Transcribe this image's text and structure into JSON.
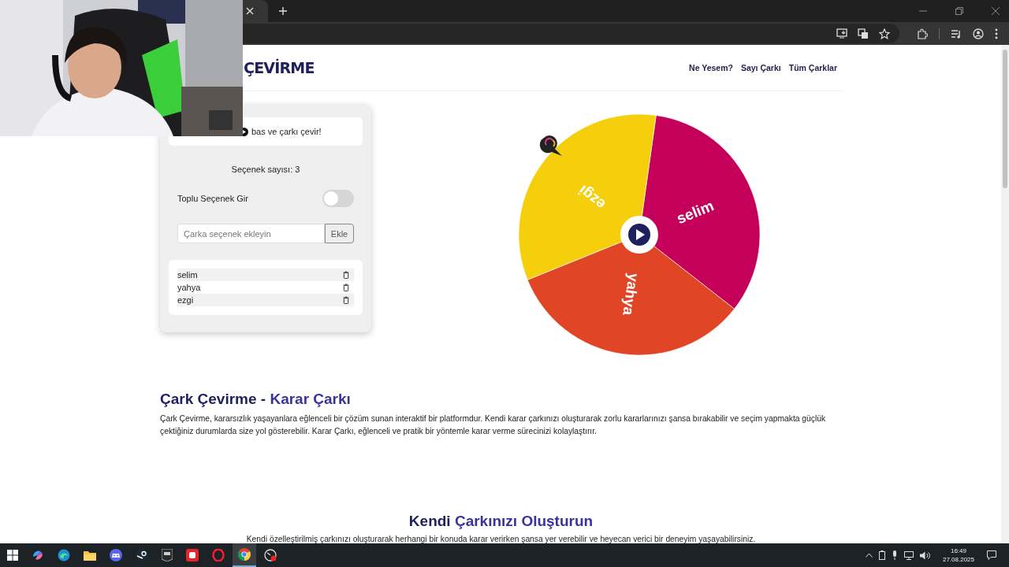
{
  "header": {
    "logo": "ÇEVİRME",
    "nav": [
      "Ne Yesem?",
      "Sayı Çarkı",
      "Tüm Çarklar"
    ]
  },
  "panel": {
    "instruction": "bas ve çarkı çevir!",
    "count_label": "Seçenek sayısı: 3",
    "bulk_toggle": {
      "label": "Toplu Seçenek Gir",
      "on": false
    },
    "add_field": {
      "placeholder": "Çarka seçenek ekleyin"
    },
    "add_button": "Ekle",
    "options": [
      "selim",
      "yahya",
      "ezgi"
    ]
  },
  "wheel": {
    "segments": [
      {
        "label": "selim",
        "color": "#c4005a"
      },
      {
        "label": "yahya",
        "color": "#e04525"
      },
      {
        "label": "ezgi",
        "color": "#f6cf0c"
      }
    ]
  },
  "about": {
    "title_start": "Çark Çevirme -",
    "title_highlight": "Karar Çarkı",
    "text": "Çark Çevirme, kararsızlık yaşayanlara eğlenceli bir çözüm sunan interaktif bir platformdur. Kendi karar çarkınızı oluşturarak zorlu kararlarınızı şansa bırakabilir ve seçim yapmakta güçlük çektiğiniz durumlarda size yol gösterebilir. Karar Çarkı, eğlenceli ve pratik bir yöntemle karar verme sürecinizi kolaylaştırır."
  },
  "create": {
    "title_start": "Kendi",
    "title_highlight": "Çarkınızı Oluşturun",
    "text": "Kendi özelleştirilmiş çarkınızı oluşturarak herhangi bir konuda karar verirken şansa yer verebilir ve heyecan verici bir deneyim yaşayabilirsiniz."
  },
  "taskbar": {
    "time": "16:49",
    "date": "27.08.2025"
  }
}
